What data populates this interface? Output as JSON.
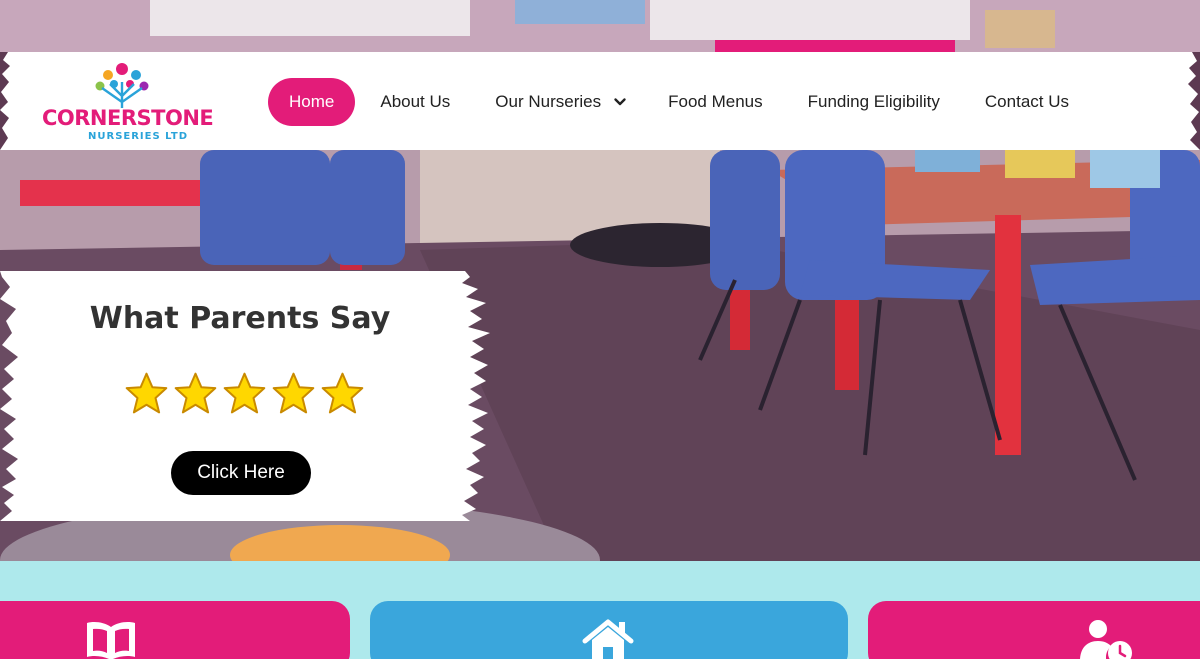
{
  "colors": {
    "brand_pink": "#e31c79",
    "brand_blue": "#2aa3d9",
    "strip_bg": "#aee9ec",
    "button_black": "#000000",
    "hero_tint": "#6e4a66"
  },
  "logo": {
    "name": "CORNERSTONE",
    "subtitle": "NURSERIES LTD"
  },
  "nav": {
    "items": [
      {
        "label": "Home",
        "active": true
      },
      {
        "label": "About Us",
        "active": false
      },
      {
        "label": "Our Nurseries",
        "active": false,
        "has_dropdown": true,
        "icon": "chevron-down-icon"
      },
      {
        "label": "Food Menus",
        "active": false
      },
      {
        "label": "Funding Eligibility",
        "active": false
      },
      {
        "label": "Contact Us",
        "active": false
      }
    ]
  },
  "testimonial": {
    "title": "What Parents Say",
    "rating": 5,
    "rating_max": 5,
    "button_label": "Click Here"
  },
  "features": [
    {
      "icon": "open-book-icon",
      "color": "#e31c79"
    },
    {
      "icon": "home-icon",
      "color": "#3aa6dc"
    },
    {
      "icon": "user-clock-icon",
      "color": "#e31c79"
    }
  ]
}
